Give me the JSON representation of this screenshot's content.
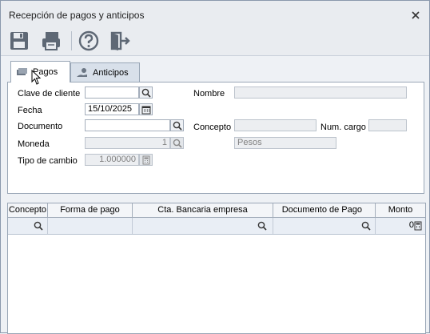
{
  "window": {
    "title": "Recepción de pagos y anticipos"
  },
  "toolbar": {
    "buttons": [
      "save-icon",
      "print-icon",
      "help-icon",
      "exit-icon"
    ]
  },
  "tabs": [
    {
      "label": "Pagos"
    },
    {
      "label": "Anticipos"
    }
  ],
  "form": {
    "clave_cliente": {
      "label": "Clave de cliente",
      "value": ""
    },
    "nombre": {
      "label": "Nombre",
      "value": ""
    },
    "fecha": {
      "label": "Fecha",
      "value": "15/10/2025"
    },
    "documento": {
      "label": "Documento",
      "value": ""
    },
    "concepto": {
      "label": "Concepto",
      "value": ""
    },
    "num_cargo": {
      "label": "Num. cargo",
      "value": ""
    },
    "moneda": {
      "label": "Moneda",
      "value": "1",
      "description": "Pesos"
    },
    "tipo_cambio": {
      "label": "Tipo de cambio",
      "value": "1.000000"
    }
  },
  "grid": {
    "columns": [
      "Concepto",
      "Forma de pago",
      "Cta. Bancaria empresa",
      "Documento de Pago",
      "Monto"
    ],
    "rows": [
      {
        "monto": "0"
      }
    ]
  }
}
